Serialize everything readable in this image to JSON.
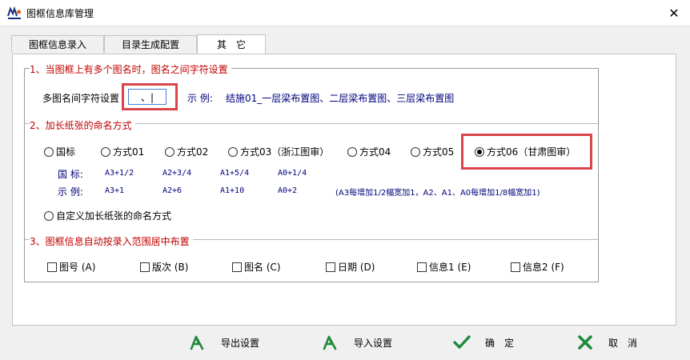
{
  "window": {
    "title": "图框信息库管理",
    "app_icon": "app-logo-icon",
    "close_glyph": "✕"
  },
  "tabs": [
    {
      "label": "图框信息录入"
    },
    {
      "label": "目录生成配置"
    },
    {
      "label": "其　它"
    }
  ],
  "section1": {
    "title": "1、当图框上有多个图名时，图名之间字符设置",
    "field_label": "多图名间字符设置",
    "field_value": "、|",
    "example_label": "示 例:",
    "example_text": "结施01_一层梁布置图、二层梁布置图、三层梁布置图"
  },
  "section2": {
    "title": "2、加长纸张的命名方式",
    "radios": [
      {
        "label": "国标",
        "checked": false
      },
      {
        "label": "方式01",
        "checked": false
      },
      {
        "label": "方式02",
        "checked": false
      },
      {
        "label": "方式03（浙江图审）",
        "checked": false
      },
      {
        "label": "方式04",
        "checked": false
      },
      {
        "label": "方式05",
        "checked": false
      },
      {
        "label": "方式06（甘肃图审）",
        "checked": true
      }
    ],
    "row1_label": "国 标:",
    "row1_values": [
      "A3+1/2",
      "A2+3/4",
      "A1+5/4",
      "A0+1/4"
    ],
    "row2_label": "示 例:",
    "row2_values": [
      "A3+1",
      "A2+6",
      "A1+10",
      "A0+2"
    ],
    "row2_note": "(A3每增加1/2幅宽加1，A2、A1、A0每增加1/8幅宽加1)",
    "custom_radio": "自定义加长纸张的命名方式"
  },
  "section3": {
    "title": "3、图框信息自动按录入范围居中布置",
    "checks": [
      {
        "label": "图号 (A)"
      },
      {
        "label": "版次 (B)"
      },
      {
        "label": "图名 (C)"
      },
      {
        "label": "日期 (D)"
      },
      {
        "label": "信息1 (E)"
      },
      {
        "label": "信息2 (F)"
      }
    ]
  },
  "buttons": {
    "export": "导出设置",
    "import": "导入设置",
    "ok": "确　定",
    "cancel": "取　消"
  },
  "colors": {
    "section_title": "#c00000",
    "example_blue": "#00007b",
    "highlight": "#d9454a",
    "icon_green": "#1f8a3a"
  }
}
